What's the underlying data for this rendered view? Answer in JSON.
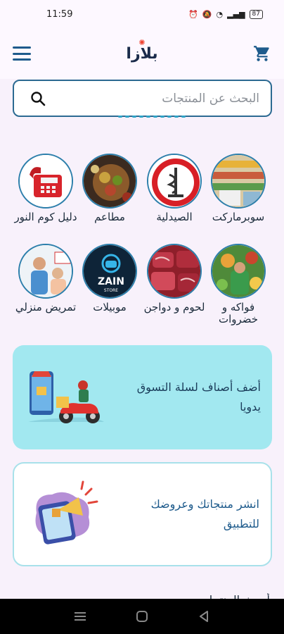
{
  "status": {
    "time": "11:59",
    "battery": "87"
  },
  "header": {
    "logo_text": "بلازا"
  },
  "search": {
    "placeholder": "البحث عن المنتجات"
  },
  "categories": [
    {
      "label": "سوبرماركت"
    },
    {
      "label": "الصيدلية"
    },
    {
      "label": "مطاعم"
    },
    {
      "label": "دليل كوم النور"
    },
    {
      "label": "فواكه و خضروات"
    },
    {
      "label": "لحوم و دواجن"
    },
    {
      "label": "موبيلات"
    },
    {
      "label": "تمريض منزلي"
    }
  ],
  "banners": {
    "manual_basket": "أضف أصناف لسلة التسوق يدويا",
    "publish_products": "انشر منتجاتك وعروضك للتطبيق"
  },
  "section_peek": "أحدث المنتجات",
  "colors": {
    "accent": "#2c6a92",
    "banner_bg": "#a2e8f0",
    "page_bg": "#f8f1fb"
  }
}
